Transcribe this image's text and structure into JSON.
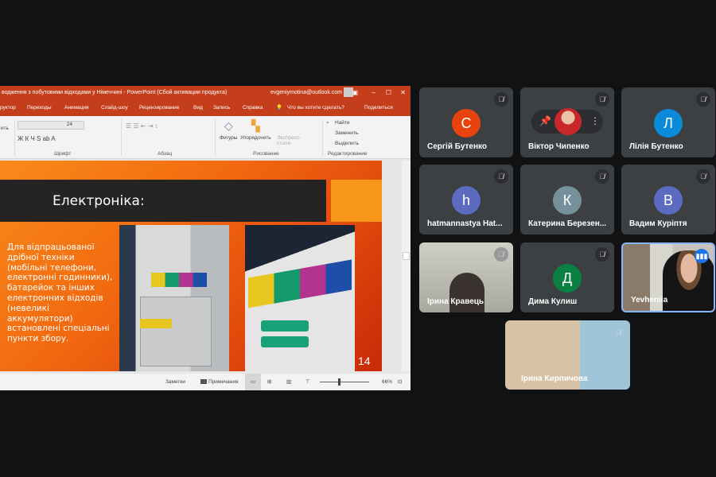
{
  "ppt": {
    "title": "водження з побутовими відходами у Німеччині  -  PowerPoint (Сбой активации продукта)",
    "account": "evgeniymotina@outlook.com",
    "tabs": [
      "руктор",
      "Переходы",
      "Анимация",
      "Слайд-шоу",
      "Рецензирование",
      "Вид",
      "Запись",
      "Справка",
      "Что вы хотите сделать?",
      "Поделиться"
    ],
    "ribbon": {
      "font_size": "24",
      "font_group": "Шрифт",
      "paragraph_group": "Абзац",
      "shapes": "Фигуры",
      "arrange": "Упорядочить",
      "quick_styles": "Экспресс-стили",
      "drawing_group": "Рисование",
      "find": "Найти",
      "replace": "Заменить",
      "select": "Выделить",
      "editing_group": "Редактирование",
      "left_cut": "ить"
    },
    "slide": {
      "title": "Електроніка:",
      "body": "Для відпрацьованої\nдрібної техніки\n(мобільні телефони,\nелектронні годинники),\nбатарейок та інших\nелектронних відходів\n(невеликі\nаккумулятори)\nвстановлені спеціальні\nпункти збору.",
      "number": "14"
    },
    "status": {
      "notes": "Заметки",
      "comments": "Примечания",
      "zoom": "66%"
    }
  },
  "meet": {
    "tiles": [
      {
        "name": "Сергій Бутенко",
        "initial": "С",
        "color": "#e8430f"
      },
      {
        "name": "Віктор Чипенко"
      },
      {
        "name": "Лілія Бутенко",
        "initial": "Л",
        "color": "#0a8ad8"
      },
      {
        "name": "hatmannastya Hat...",
        "initial": "h",
        "color": "#5c6bc0"
      },
      {
        "name": "Катерина Березен...",
        "initial": "К",
        "color": "#78909c"
      },
      {
        "name": "Вадим Куріптя",
        "initial": "В",
        "color": "#5c6bc0"
      },
      {
        "name": "Ірина Кравець"
      },
      {
        "name": "Дима Кулиш",
        "initial": "Д",
        "color": "#0b8043"
      },
      {
        "name": "Yevheniia"
      },
      {
        "name": "Ірина Кирпичова"
      }
    ]
  }
}
